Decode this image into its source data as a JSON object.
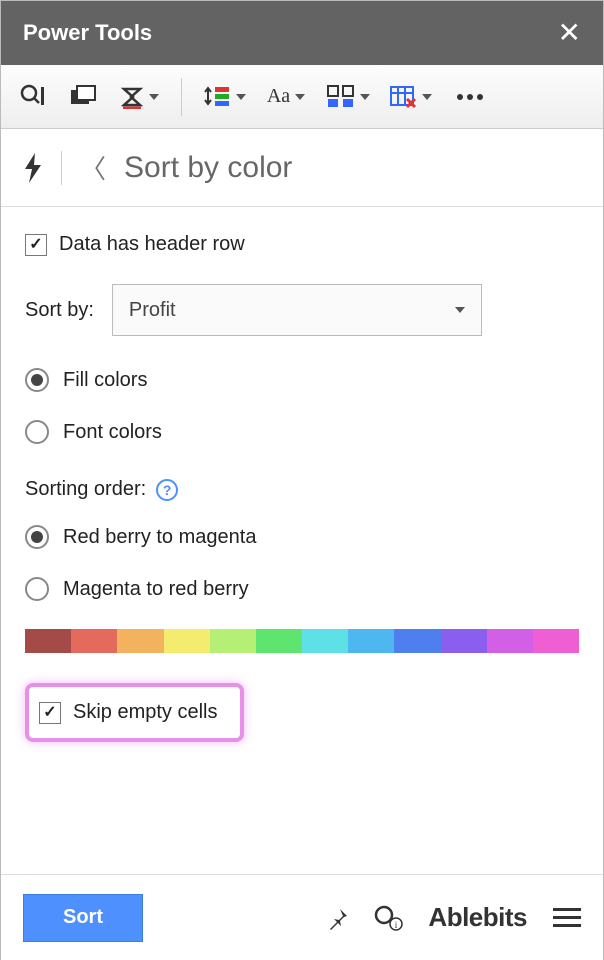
{
  "header": {
    "title": "Power Tools"
  },
  "breadcrumb": {
    "title": "Sort by color"
  },
  "form": {
    "header_row_label": "Data has header row",
    "header_row_checked": true,
    "sort_by_label": "Sort by:",
    "sort_by_value": "Profit",
    "color_type": {
      "fill": "Fill colors",
      "font": "Font colors",
      "selected": "fill"
    },
    "order_label": "Sorting order:",
    "order_options": {
      "rb_to_m": "Red berry to magenta",
      "m_to_rb": "Magenta to red berry",
      "selected": "rb_to_m"
    },
    "skip_empty_label": "Skip empty cells",
    "skip_empty_checked": true
  },
  "spectrum": [
    "#a44b48",
    "#e46a5e",
    "#f2b25e",
    "#f4ec6f",
    "#b5ef76",
    "#5fe46f",
    "#5de0e6",
    "#4fb7ef",
    "#4f7eef",
    "#8a5ff0",
    "#d35fe6",
    "#ef5fd3"
  ],
  "footer": {
    "sort_label": "Sort",
    "brand": "Ablebits"
  }
}
